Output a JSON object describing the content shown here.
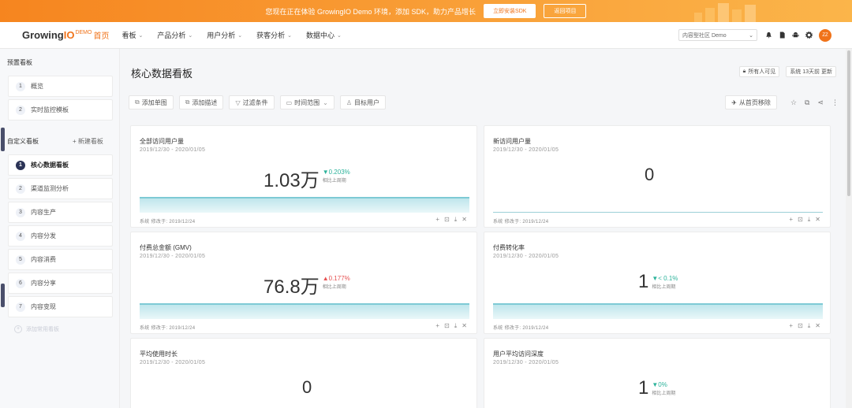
{
  "banner": {
    "message": "您现在正在体验 GrowingIO Demo 环境，添加 SDK，助力产品增长",
    "install_button": "立即安装SDK",
    "back_button": "返回项目"
  },
  "nav": {
    "logo_text": "Growing",
    "logo_io": "IO",
    "logo_demo": "DEMO",
    "home_label": "首页",
    "menu": [
      {
        "label": "看板"
      },
      {
        "label": "产品分析"
      },
      {
        "label": "用户分析"
      },
      {
        "label": "获客分析"
      },
      {
        "label": "数据中心"
      }
    ],
    "project_select": "内容型社区 Demo",
    "avatar_initials": "ZZ"
  },
  "sidebar": {
    "preset_title": "预置看板",
    "preset_items": [
      {
        "num": "1",
        "label": "概览"
      },
      {
        "num": "2",
        "label": "实时监控模板"
      }
    ],
    "custom_title": "自定义看板",
    "new_board": "+ 新建看板",
    "custom_items": [
      {
        "num": "1",
        "label": "核心数据看板",
        "active": true
      },
      {
        "num": "2",
        "label": "渠道监测分析"
      },
      {
        "num": "3",
        "label": "内容生产"
      },
      {
        "num": "4",
        "label": "内容分发"
      },
      {
        "num": "5",
        "label": "内容消费"
      },
      {
        "num": "6",
        "label": "内容分享"
      },
      {
        "num": "7",
        "label": "内容变现"
      }
    ],
    "add_common": "添加常用看板"
  },
  "main": {
    "title": "核心数据看板",
    "visibility": "所有人可见",
    "updated": "系统 13天前 更新",
    "toolbar": {
      "add_chart": "添加单图",
      "add_desc": "添加描述",
      "filter": "过滤条件",
      "time_range": "时间范围",
      "target_users": "目标用户",
      "unpin": "从首页移除"
    },
    "cards": [
      {
        "title": "全部访问用户量",
        "date": "2019/12/30 - 2020/01/05",
        "value": "1.03万",
        "change": "▼0.203%",
        "change_dir": "down",
        "change_label": "相比上周期",
        "footer": "系统 修改于: 2019/12/24"
      },
      {
        "title": "新访问用户量",
        "date": "2019/12/30 - 2020/01/05",
        "value": "0",
        "change": "",
        "change_dir": "",
        "change_label": "",
        "footer": "系统 修改于: 2019/12/24"
      },
      {
        "title": "付费总金额 (GMV)",
        "date": "2019/12/30 - 2020/01/05",
        "value": "76.8万",
        "change": "▲0.177%",
        "change_dir": "up",
        "change_label": "相比上周期",
        "footer": "系统 修改于: 2019/12/24"
      },
      {
        "title": "付费转化率",
        "date": "2019/12/30 - 2020/01/05",
        "value": "1",
        "change": "▼< 0.1%",
        "change_dir": "down",
        "change_label": "相比上周期",
        "footer": "系统 修改于: 2019/12/24"
      },
      {
        "title": "平均使用时长",
        "date": "2019/12/30 - 2020/01/05",
        "value": "0",
        "change": "",
        "change_dir": "",
        "change_label": "",
        "footer": ""
      },
      {
        "title": "用户平均访问深度",
        "date": "2019/12/30 - 2020/01/05",
        "value": "1",
        "change": "▼0%",
        "change_dir": "down",
        "change_label": "相比上周期",
        "footer": ""
      }
    ]
  }
}
